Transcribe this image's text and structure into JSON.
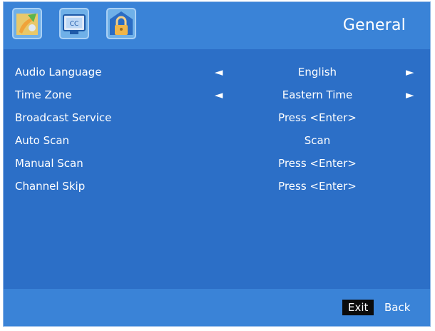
{
  "header": {
    "title": "General",
    "icons": [
      "picture-icon",
      "cc-icon",
      "lock-icon"
    ],
    "cc_text": "CC"
  },
  "menu": {
    "items": [
      {
        "label": "Audio Language",
        "value": "English",
        "has_arrows": true
      },
      {
        "label": "Time Zone",
        "value": "Eastern Time",
        "has_arrows": true
      },
      {
        "label": "Broadcast Service",
        "value": "Press <Enter>",
        "has_arrows": false
      },
      {
        "label": "Auto Scan",
        "value": "Scan",
        "has_arrows": false
      },
      {
        "label": "Manual Scan",
        "value": "Press <Enter>",
        "has_arrows": false
      },
      {
        "label": "Channel Skip",
        "value": "Press <Enter>",
        "has_arrows": false
      }
    ],
    "left_arrow": "◄",
    "right_arrow": "►"
  },
  "footer": {
    "exit_label": "Exit",
    "back_label": "Back"
  },
  "colors": {
    "panel_bg": "#2c6fc7",
    "header_bg": "#3a83d7",
    "text": "#ffffff",
    "exit_key_bg": "#0b0b0b"
  }
}
